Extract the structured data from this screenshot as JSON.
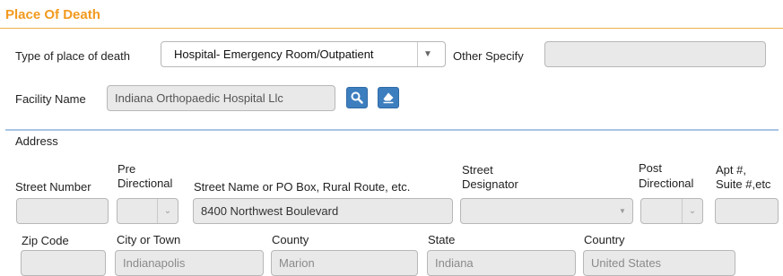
{
  "section": {
    "title": "Place Of Death"
  },
  "place": {
    "type_label": "Type of place of death",
    "type_value": "Hospital- Emergency Room/Outpatient",
    "other_label": "Other Specify",
    "other_value": ""
  },
  "facility": {
    "label": "Facility Name",
    "value": "Indiana Orthopaedic Hospital Llc"
  },
  "address": {
    "heading": "Address",
    "headers": {
      "street_number": "Street Number",
      "pre_dir_1": "Pre",
      "pre_dir_2": "Directional",
      "street_name": "Street Name or PO Box, Rural Route, etc.",
      "designator_1": "Street",
      "designator_2": "Designator",
      "post_dir_1": "Post",
      "post_dir_2": "Directional",
      "apt_1": "Apt #,",
      "apt_2": "Suite #,etc"
    },
    "values": {
      "street_number": "",
      "pre_dir": "",
      "street_name": "8400 Northwest Boulevard",
      "designator": "",
      "post_dir": "",
      "apt": ""
    },
    "zip_label": "Zip Code",
    "zip_value": "",
    "city_label": "City or Town",
    "city_value": "Indianapolis",
    "county_label": "County",
    "county_value": "Marion",
    "state_label": "State",
    "state_value": "Indiana",
    "country_label": "Country",
    "country_value": "United States"
  }
}
